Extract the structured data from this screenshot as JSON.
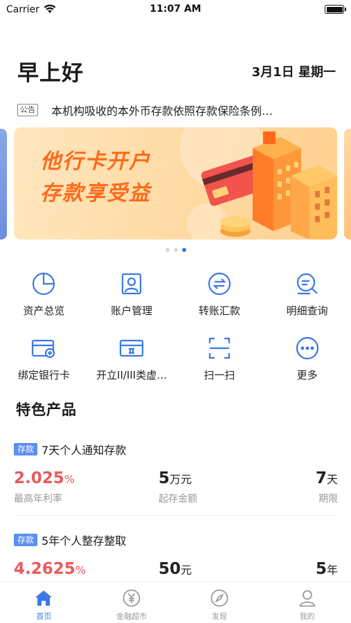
{
  "status_bar": {
    "carrier": "Carrier",
    "time": "11:07 AM"
  },
  "greeting": "早上好",
  "date": "3月1日 星期一",
  "notice": {
    "tag": "公告",
    "text": "本机构吸收的本外币存款依照存款保险条例…"
  },
  "banner": {
    "line1": "他行卡开户",
    "line2": "存款享受益",
    "page_count": 3,
    "active_index": 2
  },
  "colors": {
    "accent": "#3a78e8",
    "rate_red": "#e95a5a",
    "tag_blue": "#5b8ff0",
    "banner_orange": "#ff6a1a"
  },
  "quick_actions": [
    {
      "label": "资产总览",
      "icon": "pie-chart-icon"
    },
    {
      "label": "账户管理",
      "icon": "account-card-icon"
    },
    {
      "label": "转账汇款",
      "icon": "transfer-icon"
    },
    {
      "label": "明细查询",
      "icon": "details-search-icon"
    },
    {
      "label": "绑定银行卡",
      "icon": "bind-card-icon"
    },
    {
      "label": "开立II/III类虚…",
      "icon": "virtual-account-icon"
    },
    {
      "label": "扫一扫",
      "icon": "scan-icon"
    },
    {
      "label": "更多",
      "icon": "more-icon"
    }
  ],
  "section_title": "特色产品",
  "products": [
    {
      "tag": "存款",
      "name": "7天个人通知存款",
      "rate": "2.025",
      "rate_unit": "%",
      "rate_label": "最高年利率",
      "min_amount": "5",
      "min_amount_unit": "万元",
      "min_amount_label": "起存金额",
      "term": "7",
      "term_unit": "天",
      "term_label": "期限"
    },
    {
      "tag": "存款",
      "name": "5年个人整存整取",
      "rate": "4.2625",
      "rate_unit": "%",
      "rate_label": "",
      "min_amount": "50",
      "min_amount_unit": "元",
      "min_amount_label": "",
      "term": "5",
      "term_unit": "年",
      "term_label": ""
    }
  ],
  "tabbar": [
    {
      "label": "首页",
      "icon": "home-icon",
      "active": true
    },
    {
      "label": "金融超市",
      "icon": "yuan-icon",
      "active": false
    },
    {
      "label": "发现",
      "icon": "compass-icon",
      "active": false
    },
    {
      "label": "我的",
      "icon": "user-icon",
      "active": false
    }
  ]
}
